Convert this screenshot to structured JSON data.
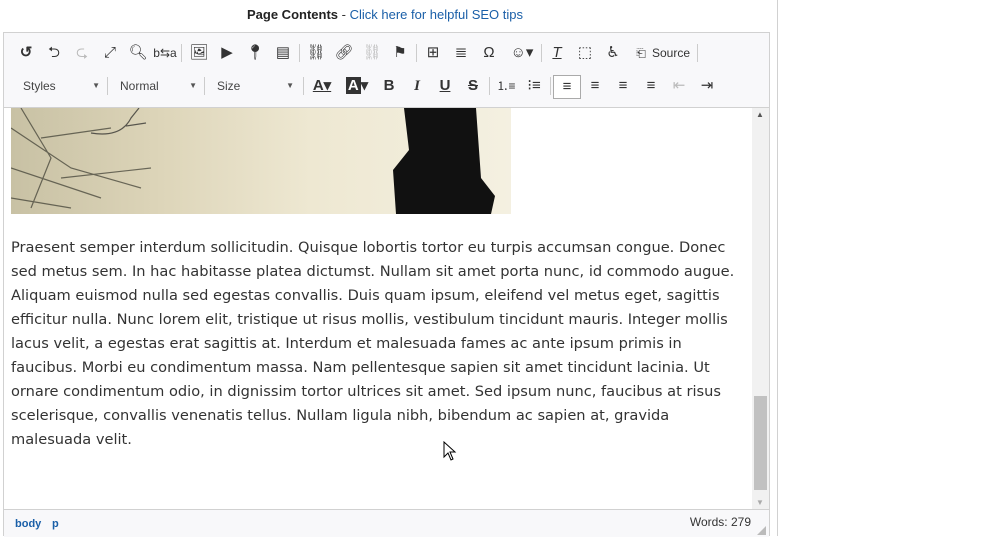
{
  "header": {
    "label": "Page Contents",
    "separator": " - ",
    "link": "Click here for helpful SEO tips"
  },
  "toolbar": {
    "source_label": "Source",
    "styles": "Styles",
    "format": "Normal",
    "size": "Size",
    "icons_row1": [
      "undo-icon",
      "undo-arrow-icon",
      "redo-icon",
      "maximize-icon",
      "find-icon",
      "replace-icon",
      "image-icon",
      "youtube-icon",
      "map-pin-icon",
      "form-icon",
      "anchor-link-icon",
      "link-icon",
      "unlink-icon",
      "flag-icon",
      "table-icon",
      "horizontal-rule-icon",
      "special-char-icon",
      "emoji-icon",
      "remove-format-icon",
      "show-blocks-icon",
      "accessibility-icon",
      "source-icon"
    ],
    "active_align": "left"
  },
  "content": {
    "lines": [
      "Praesent semper interdum sollicitudin. Quisque lobortis tortor eu turpis accumsan congue. Donec",
      "sed metus sem. In hac habitasse platea dictumst. Nullam sit amet porta nunc, id commodo augue.",
      "Aliquam euismod nulla sed egestas convallis. Duis quam ipsum, eleifend vel metus eget, sagittis",
      "efficitur nulla. Nunc lorem elit, tristique ut risus mollis, vestibulum tincidunt mauris. Integer mollis",
      "lacus velit, a egestas erat sagittis at. Interdum et malesuada fames ac ante ipsum primis in",
      "faucibus. Morbi eu condimentum massa. Nam pellentesque sapien sit amet tincidunt lacinia. Ut",
      "ornare condimentum odio, in dignissim tortor ultrices sit amet. Sed ipsum nunc, faucibus at risus",
      "scelerisque, convallis venenatis tellus. Nullam ligula nibh, bibendum ac sapien at, gravida",
      "malesuada velit."
    ]
  },
  "status": {
    "path": [
      "body",
      "p"
    ],
    "words": "Words: 279"
  },
  "colors": {
    "link": "#1a5fa8",
    "text": "#333333"
  }
}
